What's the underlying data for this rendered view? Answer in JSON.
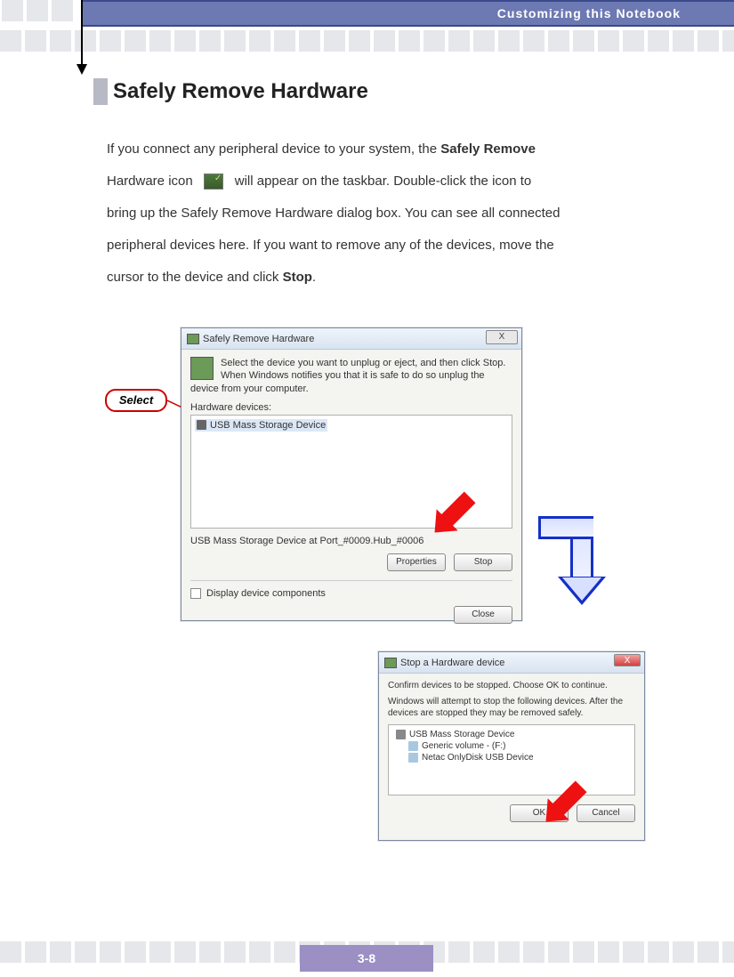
{
  "header": {
    "title": "Customizing this Notebook"
  },
  "section": {
    "heading": "Safely Remove Hardware"
  },
  "para": {
    "p1a": "If you connect any peripheral device to your system, the ",
    "p1b_bold": "Safely Remove",
    "p2a": "Hardware icon",
    "p2b": " will appear on the taskbar.  Double-click the icon to",
    "p3": "bring up the Safely Remove Hardware dialog box.   You can see all connected",
    "p4": "peripheral devices here.   If you want to remove any of the devices, move the",
    "p5a": "cursor to the device and click ",
    "p5b_bold": "Stop",
    "p5c": "."
  },
  "callout": {
    "label": "Select"
  },
  "dialog1": {
    "title": "Safely Remove Hardware",
    "close": "X",
    "instructions": "Select the device you want to unplug or eject, and then click Stop. When Windows notifies you that it is safe to do so unplug the device from your computer.",
    "devices_label": "Hardware devices:",
    "device_item": "USB Mass Storage Device",
    "status": "USB Mass Storage Device at Port_#0009.Hub_#0006",
    "btn_properties": "Properties",
    "btn_stop": "Stop",
    "chk_label": "Display device components",
    "btn_close": "Close"
  },
  "dialog2": {
    "title": "Stop a Hardware device",
    "close": "X",
    "line1": "Confirm devices to be stopped. Choose OK to continue.",
    "line2": "Windows will attempt to stop the following devices. After the devices are stopped they may be removed safely.",
    "item1": "USB Mass Storage Device",
    "item2": "Generic volume - (F:)",
    "item3": "Netac OnlyDisk USB Device",
    "btn_ok": "OK",
    "btn_cancel": "Cancel"
  },
  "page_number": "3-8"
}
